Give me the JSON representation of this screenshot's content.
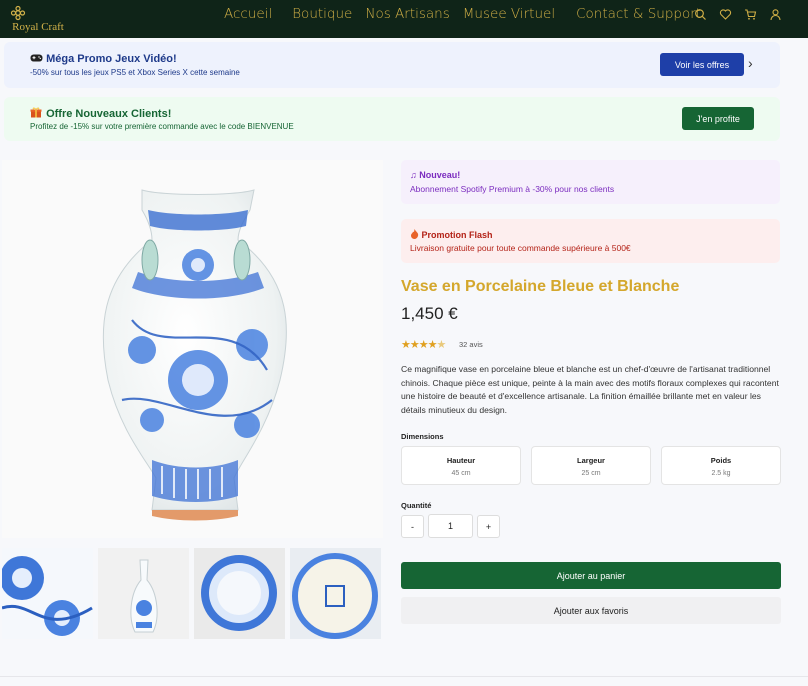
{
  "brand": {
    "name": "Royal Craft",
    "color": "#d4b34a"
  },
  "nav": {
    "links": [
      "Accueil",
      "Boutique",
      "Nos Artisans",
      "Musee Virtuel",
      "Contact & Support"
    ],
    "icons": [
      "search-icon",
      "heart-icon",
      "cart-icon",
      "user-icon"
    ]
  },
  "banners": {
    "game": {
      "title": "Méga Promo Jeux Vidéo!",
      "subtitle": "-50% sur tous les jeux PS5 et Xbox Series X cette semaine",
      "button": "Voir les offres",
      "icon": "gamepad-icon"
    },
    "newclient": {
      "title": "Offre Nouveaux Clients!",
      "subtitle": "Profitez de -15% sur votre première commande avec le code BIENVENUE",
      "button": "J'en profite",
      "icon": "gift-icon"
    }
  },
  "promos": {
    "spotify": {
      "title": "Nouveau!",
      "text": "Abonnement Spotify Premium à -30% pour nos clients",
      "icon": "music-note-icon"
    },
    "flash": {
      "title": "Promotion Flash",
      "text": "Livraison gratuite pour toute commande supérieure à 500€",
      "icon": "fire-icon"
    }
  },
  "product": {
    "title": "Vase en Porcelaine Bleue et Blanche",
    "price": "1,450 €",
    "rating": 4.5,
    "reviews": "32 avis",
    "description": "Ce magnifique vase en porcelaine bleue et blanche est un chef-d'œuvre de l'artisanat traditionnel chinois. Chaque pièce est unique, peinte à la main avec des motifs floraux complexes qui racontent une histoire de beauté et d'excellence artisanale. La finition émaillée brillante met en valeur les détails minutieux du design.",
    "dimensions_label": "Dimensions",
    "dimensions": [
      {
        "label": "Hauteur",
        "value": "45 cm"
      },
      {
        "label": "Largeur",
        "value": "25 cm"
      },
      {
        "label": "Poids",
        "value": "2.5 kg"
      }
    ],
    "quantity_label": "Quantité",
    "quantity": "1",
    "minus": "-",
    "plus": "+",
    "add_to_cart": "Ajouter au panier",
    "add_to_favorites": "Ajouter aux favoris"
  },
  "colors": {
    "nav_bg": "#0f2418",
    "accent_gold": "#d4a72c",
    "primary_green": "#166534",
    "primary_blue": "#1e3fa8"
  }
}
